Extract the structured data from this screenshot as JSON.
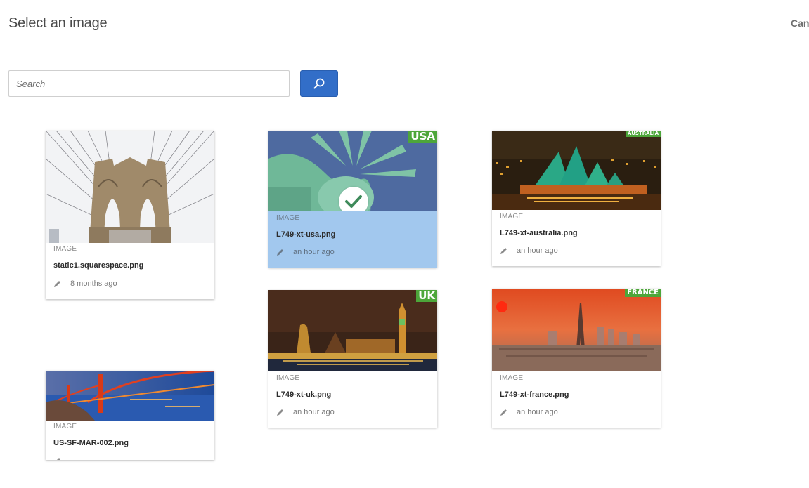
{
  "header": {
    "title": "Select an image",
    "cancel_label": "Cancel"
  },
  "search": {
    "placeholder": "Search",
    "value": "",
    "button_icon": "search-icon"
  },
  "assets": [
    {
      "type": "IMAGE",
      "filename": "static1.squarespace.png",
      "modified": "8 months ago",
      "selected": false,
      "country_tag": "",
      "icon": "pencil-icon"
    },
    {
      "type": "IMAGE",
      "filename": "L749-xt-usa.png",
      "modified": "an hour ago",
      "selected": true,
      "country_tag": "USA",
      "icon": "pencil-icon"
    },
    {
      "type": "IMAGE",
      "filename": "L749-xt-australia.png",
      "modified": "an hour ago",
      "selected": false,
      "country_tag": "AUSTRALIA",
      "icon": "pencil-icon"
    },
    {
      "type": "IMAGE",
      "filename": "L749-xt-uk.png",
      "modified": "an hour ago",
      "selected": false,
      "country_tag": "UK",
      "icon": "pencil-icon"
    },
    {
      "type": "IMAGE",
      "filename": "L749-xt-france.png",
      "modified": "an hour ago",
      "selected": false,
      "country_tag": "FRANCE",
      "icon": "pencil-icon"
    },
    {
      "type": "IMAGE",
      "filename": "US-SF-MAR-002.png",
      "modified": "",
      "selected": false,
      "country_tag": "",
      "icon": "pencil-icon"
    }
  ],
  "colors": {
    "accent": "#326ec8",
    "selected_bg": "#a2c8ee",
    "country_tag": "#4da63a"
  }
}
